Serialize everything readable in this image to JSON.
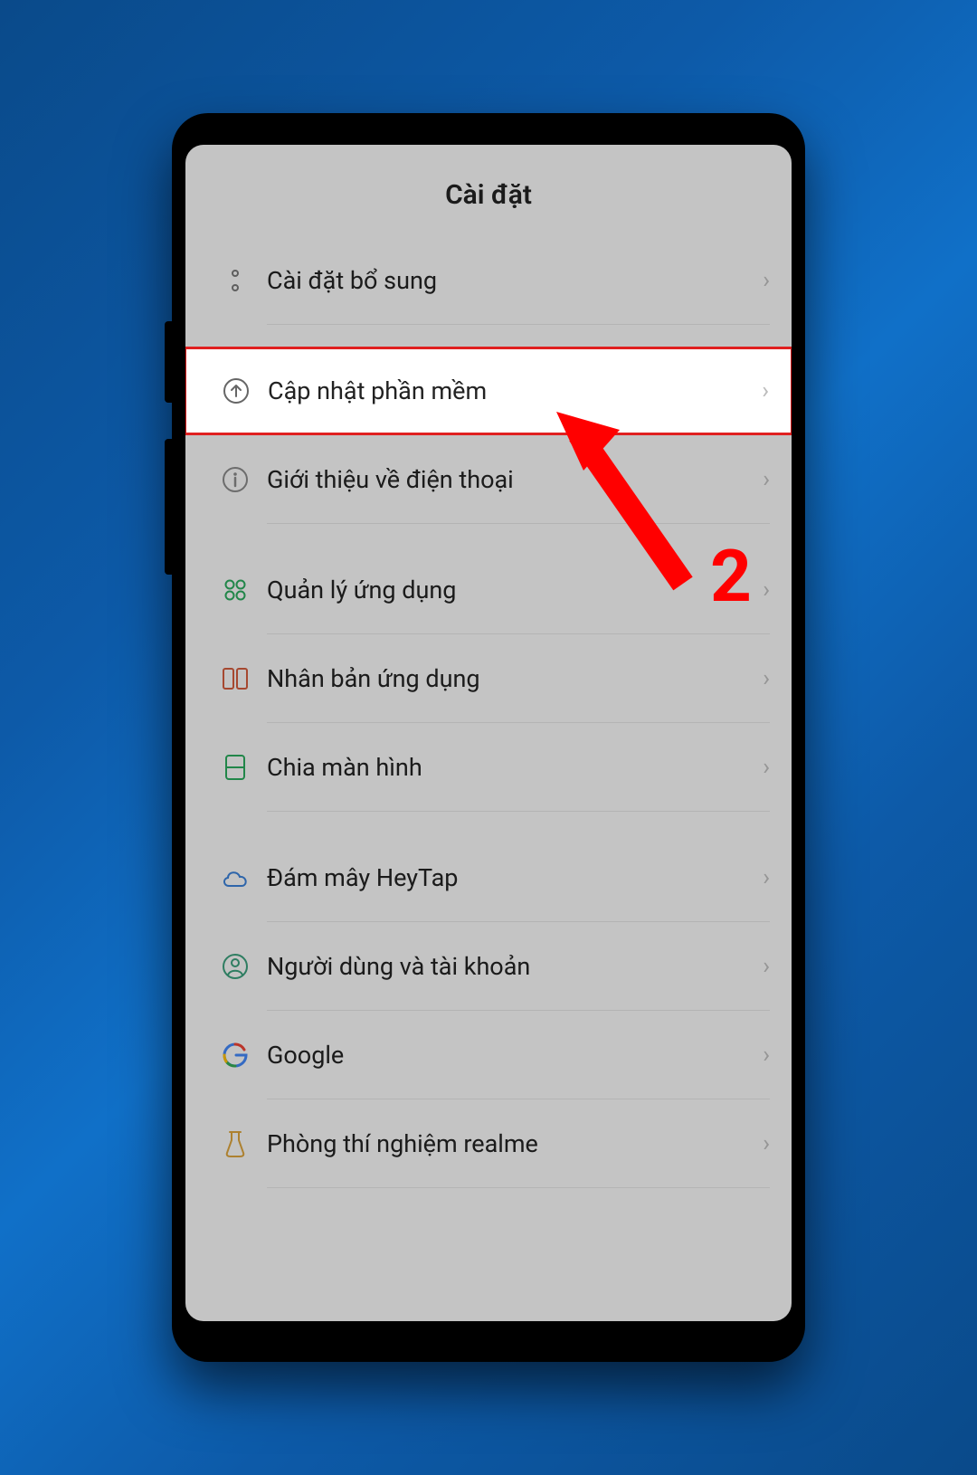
{
  "header": {
    "title": "Cài đặt"
  },
  "annotation": {
    "step_number": "2"
  },
  "settings": {
    "items": [
      {
        "label": "Cài đặt bổ sung",
        "icon": "more-dots",
        "highlighted": false
      },
      {
        "label": "Cập nhật phần mềm",
        "icon": "update-arrow",
        "highlighted": true
      },
      {
        "label": "Giới thiệu về điện thoại",
        "icon": "info",
        "highlighted": false
      },
      {
        "label": "Quản lý ứng dụng",
        "icon": "apps-grid",
        "highlighted": false
      },
      {
        "label": "Nhân bản ứng dụng",
        "icon": "clone-panels",
        "highlighted": false
      },
      {
        "label": "Chia màn hình",
        "icon": "split-screen",
        "highlighted": false
      },
      {
        "label": "Đám mây HeyTap",
        "icon": "cloud",
        "highlighted": false
      },
      {
        "label": "Người dùng và tài khoản",
        "icon": "user",
        "highlighted": false
      },
      {
        "label": "Google",
        "icon": "google",
        "highlighted": false
      },
      {
        "label": "Phòng thí nghiệm realme",
        "icon": "lab-flask",
        "highlighted": false
      }
    ]
  }
}
